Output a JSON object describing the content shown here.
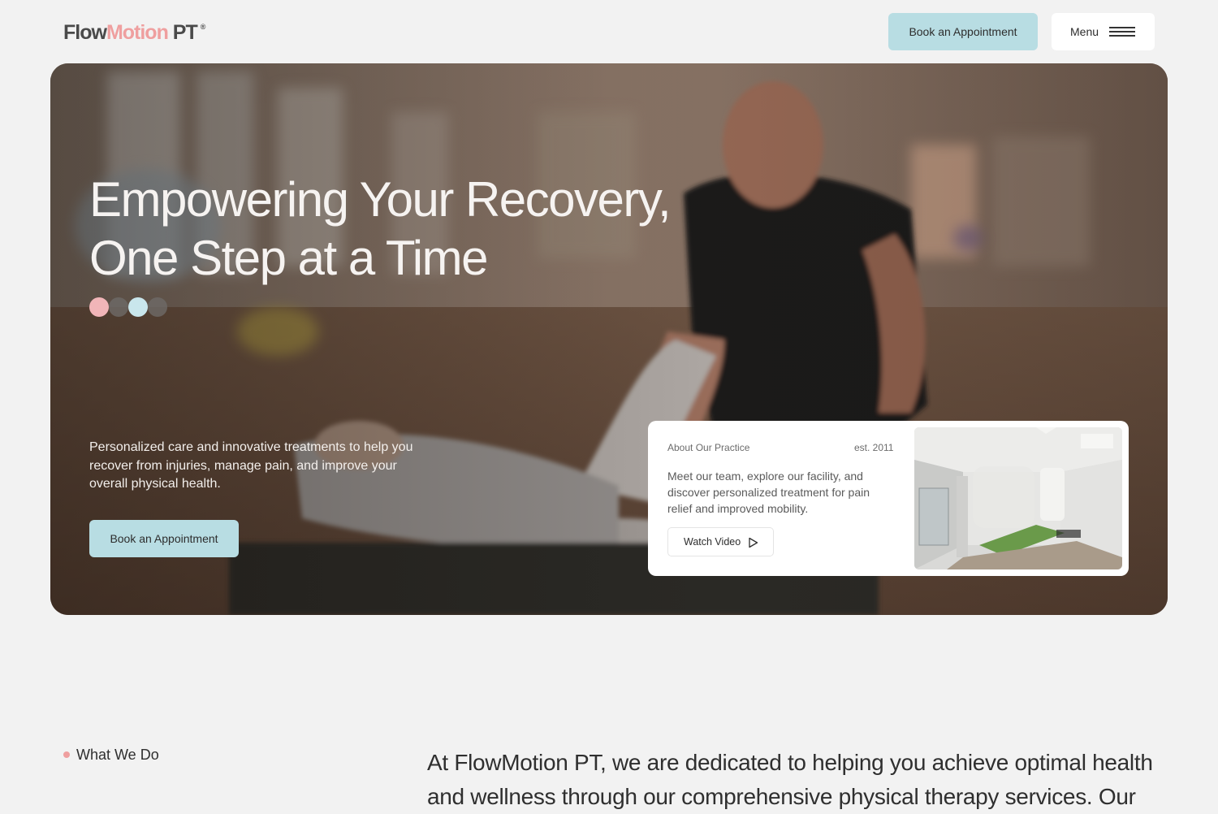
{
  "header": {
    "logo_part1": "Flow",
    "logo_part2": "Motion",
    "logo_part3": " PT",
    "logo_mark": "®",
    "book_label": "Book an Appointment",
    "menu_label": "Menu"
  },
  "hero": {
    "title_line1": "Empowering Your Recovery,",
    "title_line2": "One Step at a Time",
    "dots": [
      "#f1b5b8",
      "#6e6a68",
      "#c9e6ec",
      "#6e6a68"
    ],
    "description": "Personalized care and innovative treatments to help you recover from injuries, manage pain, and improve your overall physical health.",
    "book_label": "Book an Appointment"
  },
  "about": {
    "label": "About Our Practice",
    "est": "est. 2011",
    "text": "Meet our team, explore our facility, and discover personalized treatment for pain relief and improved mobility.",
    "watch_label": "Watch Video"
  },
  "section": {
    "tag": "What We Do",
    "body": "At FlowMotion PT, we are dedicated to helping you achieve optimal health and wellness through our comprehensive physical therapy services. Our"
  },
  "colors": {
    "accent_pink": "#ef9f9f",
    "accent_blue": "#b8dde3",
    "background": "#f2f2f2"
  },
  "icons": {
    "menu": "hamburger-icon",
    "play": "play-icon"
  }
}
